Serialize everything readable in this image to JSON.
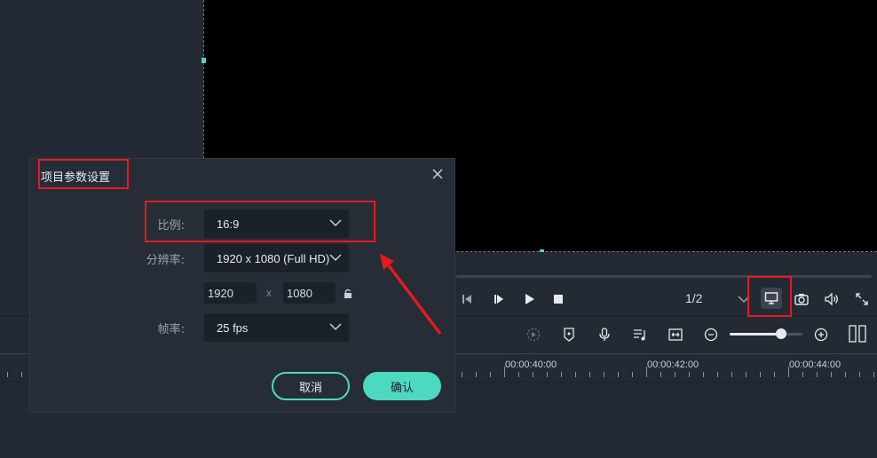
{
  "dialog": {
    "title": "项目参数设置",
    "ratio_label": "比例:",
    "ratio_value": "16:9",
    "resolution_label": "分辨率:",
    "resolution_value": "1920 x 1080 (Full HD)",
    "width_value": "1920",
    "height_value": "1080",
    "x_separator": "x",
    "framerate_label": "帧率:",
    "framerate_value": "25 fps",
    "cancel_label": "取消",
    "ok_label": "确认"
  },
  "player": {
    "ratio_display": "1/2"
  },
  "timeline": {
    "time_labels": [
      "00:00:40:00",
      "00:00:42:00",
      "00:00:44:00"
    ]
  },
  "colors": {
    "accent": "#4dd8c2",
    "annotation_red": "#e8191e",
    "background": "#232a33"
  },
  "icons": [
    "close-icon",
    "chevron-down-icon",
    "lock-icon",
    "prev-frame-icon",
    "next-frame-icon",
    "play-icon",
    "stop-icon",
    "display-settings-icon",
    "snapshot-icon",
    "volume-icon",
    "fullscreen-icon",
    "render-preview-icon",
    "marker-icon",
    "microphone-icon",
    "audio-mixer-icon",
    "fit-timeline-icon",
    "zoom-out-icon",
    "zoom-in-icon",
    "split-view-icon"
  ]
}
